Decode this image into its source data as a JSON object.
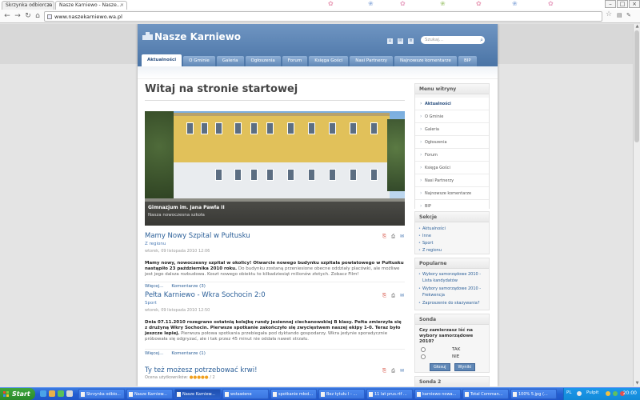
{
  "browser": {
    "tabs": [
      {
        "label": "Skrzynka odbiorcza"
      },
      {
        "label": "Nasze Karniewo - Nasze..."
      }
    ],
    "url": "www.naszekarniewo.wa.pl"
  },
  "site": {
    "logo_text": "Nasze Karniewo",
    "search_placeholder": "Szukaj...",
    "nav": [
      {
        "label": "Aktualności",
        "active": true
      },
      {
        "label": "O Gminie"
      },
      {
        "label": "Galeria"
      },
      {
        "label": "Ogłoszenia"
      },
      {
        "label": "Forum"
      },
      {
        "label": "Księga Gości"
      },
      {
        "label": "Nasi Partnerzy"
      },
      {
        "label": "Najnowsze komentarze"
      },
      {
        "label": "BIP"
      }
    ],
    "page_title": "Witaj na stronie startowej",
    "hero": {
      "caption_title": "Gimnazjum im. Jana Pawła II",
      "caption_sub": "Nasza nowoczesna szkoła"
    },
    "articles": [
      {
        "title": "Mamy Nowy Szpital w Pułtusku",
        "category": "Z regionu",
        "date": "wtorek, 09 listopada 2010 12:06",
        "body_bold": "Mamy nowy, nowoczesny szpital w okolicy! Otwarcie nowego budynku szpitala powiatowego w Pułtusku nastąpiło 23 października 2010 roku.",
        "body_soft": " Do budynku zostaną przeniesione obecne oddziały placówki, ale możliwe jest jego dalsza rozbudowa. Koszt nowego obiektu to kilkadziesiąt milionów złotych. Zobacz Film!",
        "more_label": "Więcej...",
        "comments_label": "Komentarze (3)"
      },
      {
        "title": "Pełta Karniewo - Wkra Sochocin 2:0",
        "category": "Sport",
        "date": "wtorek, 09 listopada 2010 12:50",
        "body_bold": "Dnia 07.11.2010 rozegrano ostatnią kolejkę rundy jesiennej ciechanowskiej B klasy. Pełta zmierzyła się z drużyną Wkry Sochocin. Pierwsze spotkanie zakończyło się zwycięstwem naszej ekipy 1-0. Teraz było jeszcze lepiej.",
        "body_soft": " Pierwsza połowa spotkania przebiegała pod dyktando gospodarzy. Wkra jedynie sporadycznie próbowała się odgryzać, ale i tak przez 45 minut nie oddała nawet strzału.",
        "more_label": "Więcej...",
        "comments_label": "Komentarze (1)"
      },
      {
        "title": "Ty też możesz potrzebować krwi!",
        "rating_label": "Ocena użytkowników:",
        "rating_value": "/ 2"
      }
    ],
    "sidebar": {
      "menu_title": "Menu witryny",
      "menu": [
        "Aktualności",
        "O Gminie",
        "Galeria",
        "Ogłoszenia",
        "Forum",
        "Księga Gości",
        "Nasi Partnerzy",
        "Najnowsze komentarze",
        "BIP"
      ],
      "sections_title": "Sekcje",
      "sections": [
        "Aktualności",
        "Inne",
        "Sport",
        "Z regionu"
      ],
      "popular_title": "Popularne",
      "popular": [
        "Wybory samorządowe 2010 - Lista kandydatów",
        "Wybory samorządowe 2010 - Frekwencja",
        "Zaproszenie do skazywania?"
      ],
      "poll_title": "Sonda",
      "poll_question": "Czy zamierzasz iść na wybory samorządowe 2010?",
      "poll_options": [
        "TAK",
        "NIE"
      ],
      "poll_vote": "Głosuj",
      "poll_results": "Wyniki",
      "poll2_title": "Sonda 2"
    }
  },
  "taskbar": {
    "start_label": "Start",
    "tasks": [
      "Skrzynka odbio...",
      "Nasze Karniew...",
      "Nasze Karniew...",
      "wstawiene",
      "spotkanie młod...",
      "Bez tytułu I - ...",
      "11 lat prus.rtf ...",
      "karniewo nowa...",
      "Total Comman...",
      "100% 5.jpg (..."
    ],
    "lang": "PL",
    "pulpit": "Pulpit",
    "clock": "20:00"
  },
  "colors": {
    "brand_blue": "#4a74a6",
    "link_blue": "#2b5f98",
    "taskbar_blue": "#245ed1",
    "start_green": "#2a8a2a"
  }
}
